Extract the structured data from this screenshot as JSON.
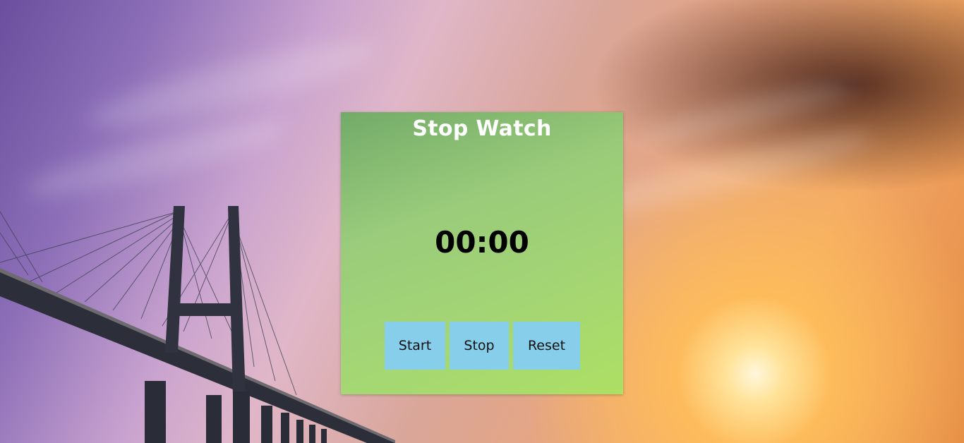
{
  "app": {
    "title": "Stop Watch"
  },
  "stopwatch": {
    "display": "00:00",
    "buttons": {
      "start_label": "Start",
      "stop_label": "Stop",
      "reset_label": "Reset"
    }
  },
  "colors": {
    "card_background": "#9ed06f",
    "button_background": "#87ceeb",
    "title_text": "#ffffff",
    "time_text": "#000000"
  }
}
